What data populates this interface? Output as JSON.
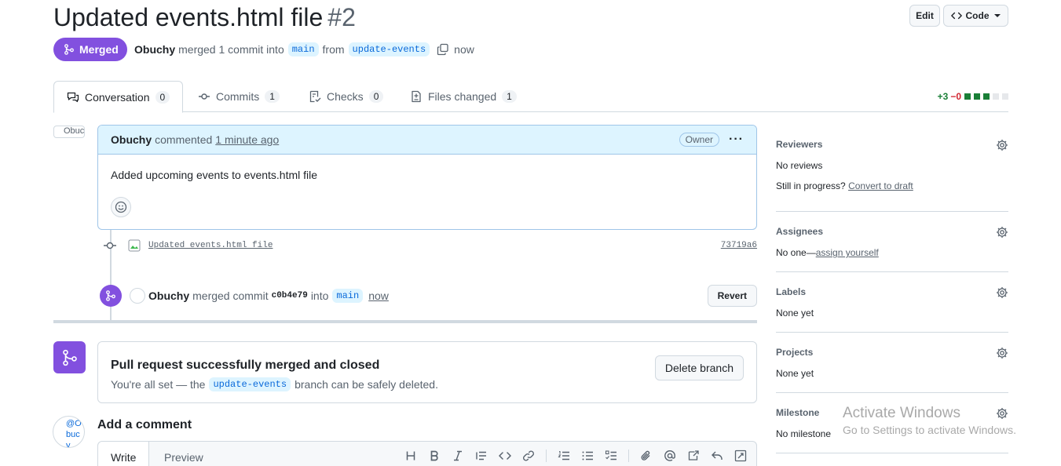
{
  "header": {
    "title": "Updated events.html file",
    "number": "#2",
    "edit_label": "Edit",
    "code_label": "Code",
    "status": "Merged",
    "author": "Obuchy",
    "merged_text": "merged 1 commit into",
    "base_branch": "main",
    "from_text": "from",
    "head_branch": "update-events",
    "time": "now"
  },
  "tabs": [
    {
      "label": "Conversation",
      "count": "0"
    },
    {
      "label": "Commits",
      "count": "1"
    },
    {
      "label": "Checks",
      "count": "0"
    },
    {
      "label": "Files changed",
      "count": "1"
    }
  ],
  "diffstat": {
    "additions": "+3",
    "deletions": "−0"
  },
  "comment": {
    "avatar_alt": "Obuchy",
    "author": "Obuchy",
    "action": "commented",
    "time": "1 minute ago",
    "role": "Owner",
    "body": "Added upcoming events to events.html file"
  },
  "commit": {
    "message": "Updated events.html file",
    "sha": "73719a6"
  },
  "merge_event": {
    "author": "Obuchy",
    "action": "merged commit",
    "sha": "c0b4e79",
    "into": "into",
    "branch": "main",
    "time": "now",
    "revert_label": "Revert"
  },
  "merge_box": {
    "heading": "Pull request successfully merged and closed",
    "sub_prefix": "You're all set — the",
    "branch": "update-events",
    "sub_suffix": "branch can be safely deleted.",
    "delete_label": "Delete branch"
  },
  "new_comment": {
    "avatar_alt_1": "@O",
    "avatar_alt_2": "buc",
    "avatar_alt_3": "y",
    "heading": "Add a comment",
    "write_tab": "Write",
    "preview_tab": "Preview"
  },
  "sidebar": {
    "reviewers": {
      "label": "Reviewers",
      "value": "No reviews",
      "progress": "Still in progress?",
      "link": "Convert to draft"
    },
    "assignees": {
      "label": "Assignees",
      "value": "No one—",
      "link": "assign yourself"
    },
    "labels": {
      "label": "Labels",
      "value": "None yet"
    },
    "projects": {
      "label": "Projects",
      "value": "None yet"
    },
    "milestone": {
      "label": "Milestone",
      "value": "No milestone"
    }
  },
  "watermark": {
    "line1": "Activate Windows",
    "line2": "Go to Settings to activate Windows."
  },
  "colors": {
    "merged": "#8250df",
    "link": "#0969da",
    "add": "#1a7f37",
    "del": "#d1242f"
  }
}
